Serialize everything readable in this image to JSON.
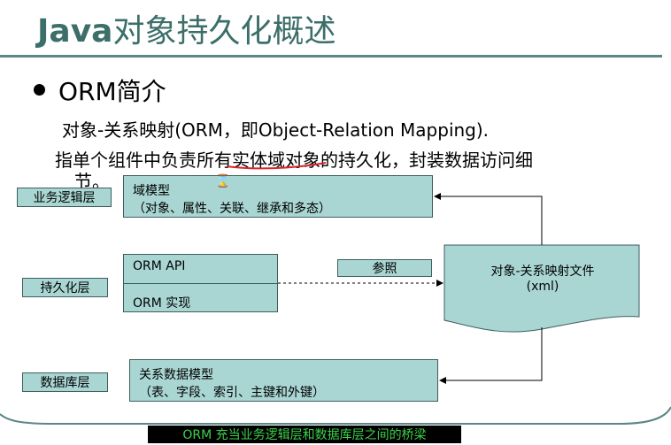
{
  "slide": {
    "title_latin": "Java",
    "title_cjk": "对象持久化概述",
    "bullet": "ORM简介",
    "para1": "对象-关系映射(ORM，即Object-Relation Mapping).",
    "para2": "指单个组件中负责所有实体域对象的持久化，封装数据访问细",
    "para3": "节。"
  },
  "diagram": {
    "layers": {
      "business": "业务逻辑层",
      "persistence": "持久化层",
      "database": "数据库层"
    },
    "domain_model": {
      "title": "域模型",
      "detail": "（对象、属性、关联、继承和多态）"
    },
    "orm_api": "ORM API",
    "orm_impl": "ORM 实现",
    "reference": "参照",
    "mapping_file": {
      "line1": "对象-关系映射文件",
      "line2": "(xml)"
    },
    "relational_model": {
      "title": "关系数据模型",
      "detail": "（表、字段、索引、主键和外键）"
    }
  },
  "banner": "ORM 充当业务逻辑层和数据库层之间的桥梁",
  "colors": {
    "title": "#3c6e6a",
    "box_fill": "#a9d6d3",
    "box_border": "#3e5e5c",
    "annotation_red": "#d8262a",
    "banner_bg": "#000000",
    "banner_text": "#3cd24a"
  },
  "icons": {
    "cursor": "hourglass-icon"
  }
}
